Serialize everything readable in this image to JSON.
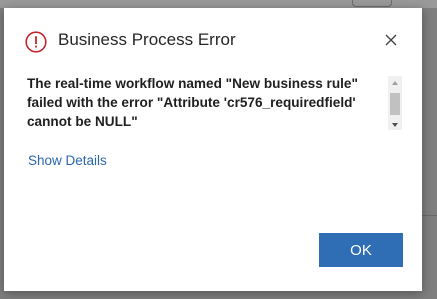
{
  "dialog": {
    "title": "Business Process Error",
    "icon": "error-circle-icon",
    "close_icon": "close-icon",
    "message": "The real-time workflow named \"New business rule\" failed with the error \"Attribute 'cr576_requiredfield' cannot be NULL\"",
    "show_details_label": "Show Details",
    "ok_label": "OK"
  },
  "colors": {
    "error_red": "#c4262e",
    "link_blue": "#2b66b0",
    "button_blue": "#2f6db5"
  }
}
